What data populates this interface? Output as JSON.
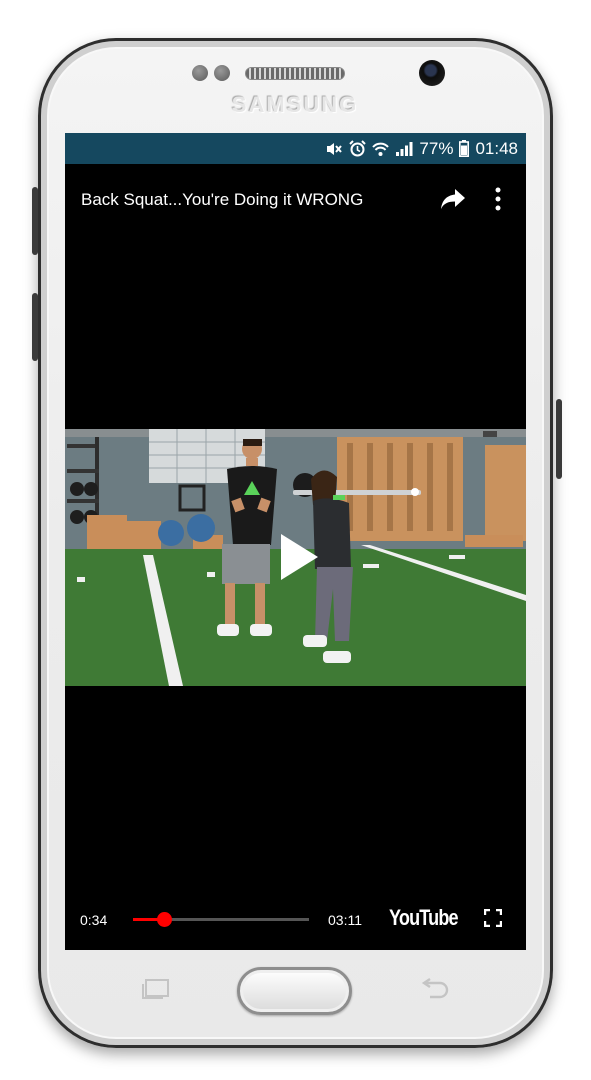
{
  "device": {
    "brand": "SAMSUNG"
  },
  "status_bar": {
    "battery_percent": "77%",
    "time": "01:48",
    "icons": [
      "mute-icon",
      "alarm-icon",
      "wifi-icon",
      "signal-icon",
      "battery-icon"
    ]
  },
  "player": {
    "video_title": "Back Squat...You're Doing it WRONG",
    "current_time": "0:34",
    "duration": "03:11",
    "progress_fraction": 0.178,
    "logo_text": "YouTube",
    "accent_color": "#ff0000"
  },
  "colors": {
    "status_bar_bg": "#15485f"
  }
}
